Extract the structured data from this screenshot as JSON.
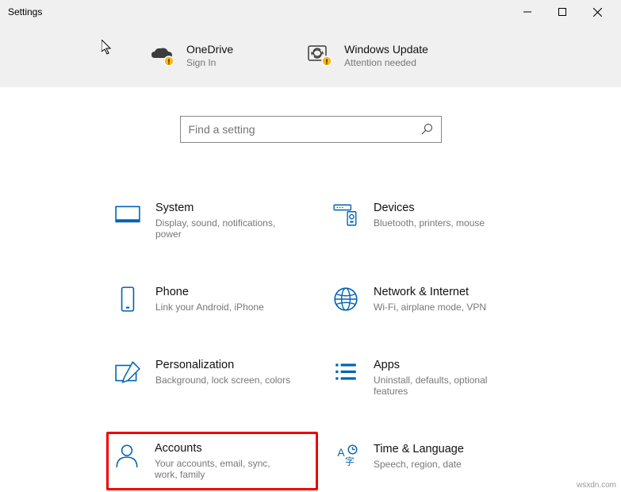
{
  "window": {
    "title": "Settings"
  },
  "notices": [
    {
      "title": "OneDrive",
      "sub": "Sign In"
    },
    {
      "title": "Windows Update",
      "sub": "Attention needed"
    }
  ],
  "search": {
    "placeholder": "Find a setting"
  },
  "tiles": [
    {
      "title": "System",
      "sub": "Display, sound, notifications, power"
    },
    {
      "title": "Devices",
      "sub": "Bluetooth, printers, mouse"
    },
    {
      "title": "Phone",
      "sub": "Link your Android, iPhone"
    },
    {
      "title": "Network & Internet",
      "sub": "Wi-Fi, airplane mode, VPN"
    },
    {
      "title": "Personalization",
      "sub": "Background, lock screen, colors"
    },
    {
      "title": "Apps",
      "sub": "Uninstall, defaults, optional features"
    },
    {
      "title": "Accounts",
      "sub": "Your accounts, email, sync, work, family"
    },
    {
      "title": "Time & Language",
      "sub": "Speech, region, date"
    }
  ],
  "watermark": "wsxdn.com"
}
